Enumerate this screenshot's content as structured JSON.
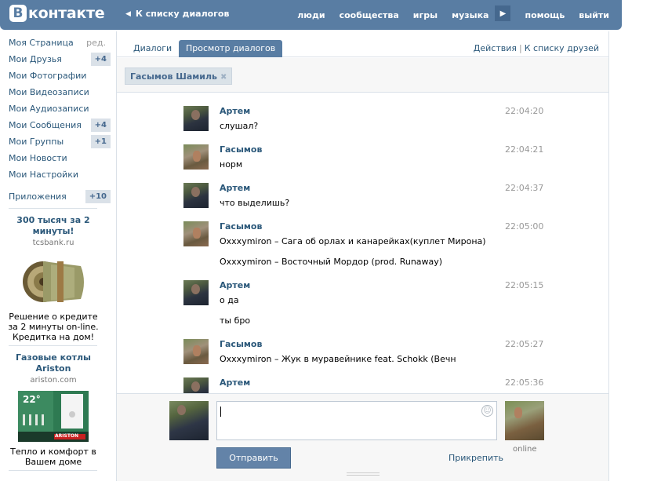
{
  "header": {
    "logo_letter": "В",
    "logo_text": "контакте",
    "back_label": "К списку диалогов",
    "nav": [
      "люди",
      "сообщества",
      "игры",
      "музыка",
      "помощь",
      "выйти"
    ]
  },
  "sidebar": {
    "items": [
      {
        "label": "Моя Страница",
        "edit": "ред."
      },
      {
        "label": "Мои Друзья",
        "badge": "+4"
      },
      {
        "label": "Мои Фотографии"
      },
      {
        "label": "Мои Видеозаписи"
      },
      {
        "label": "Мои Аудиозаписи"
      },
      {
        "label": "Мои Сообщения",
        "badge": "+4"
      },
      {
        "label": "Мои Группы",
        "badge": "+1"
      },
      {
        "label": "Мои Новости"
      },
      {
        "label": "Мои Настройки"
      }
    ],
    "apps": {
      "label": "Приложения",
      "badge": "+10"
    },
    "ads": [
      {
        "title": "300 тысяч за 2 минуты!",
        "domain": "tcsbank.ru",
        "text": "Решение о кредите за 2 минуты on-line. Кредитка на дом!"
      },
      {
        "title": "Газовые котлы Ariston",
        "domain": "ariston.com",
        "text": "Тепло и комфорт в Вашем доме",
        "image_text": "22°",
        "brand": "ARISTON"
      }
    ]
  },
  "tabs": {
    "dialogs": "Диалоги",
    "view": "Просмотр диалогов",
    "actions": "Действия",
    "to_friends": "К списку друзей"
  },
  "filter": {
    "chip": "Гасымов Шамиль"
  },
  "messages": [
    {
      "author": "Артем",
      "time": "22:04:20",
      "lines": [
        "слушал?"
      ],
      "avatar": "artem"
    },
    {
      "author": "Гасымов",
      "time": "22:04:21",
      "lines": [
        "норм"
      ],
      "avatar": "gas"
    },
    {
      "author": "Артем",
      "time": "22:04:37",
      "lines": [
        "что выделишь?"
      ],
      "avatar": "artem"
    },
    {
      "author": "Гасымов",
      "time": "22:05:00",
      "lines": [
        "Oxxxymiron – Сага об орлах и канарейках(куплет Мирона)",
        "Oxxxymiron – Восточный Мордор (prod. Runaway)"
      ],
      "avatar": "gas"
    },
    {
      "author": "Артем",
      "time": "22:05:15",
      "lines": [
        "о да",
        "ты бро"
      ],
      "avatar": "artem"
    },
    {
      "author": "Гасымов",
      "time": "22:05:27",
      "lines": [
        "Oxxxymiron – Жук в муравейнике feat. Schokk (Вечн"
      ],
      "avatar": "gas"
    },
    {
      "author": "Артем",
      "time": "22:05:36",
      "lines": [],
      "avatar": "artem"
    }
  ],
  "composer": {
    "send_label": "Отправить",
    "attach_label": "Прикрепить",
    "peer_status": "online"
  }
}
